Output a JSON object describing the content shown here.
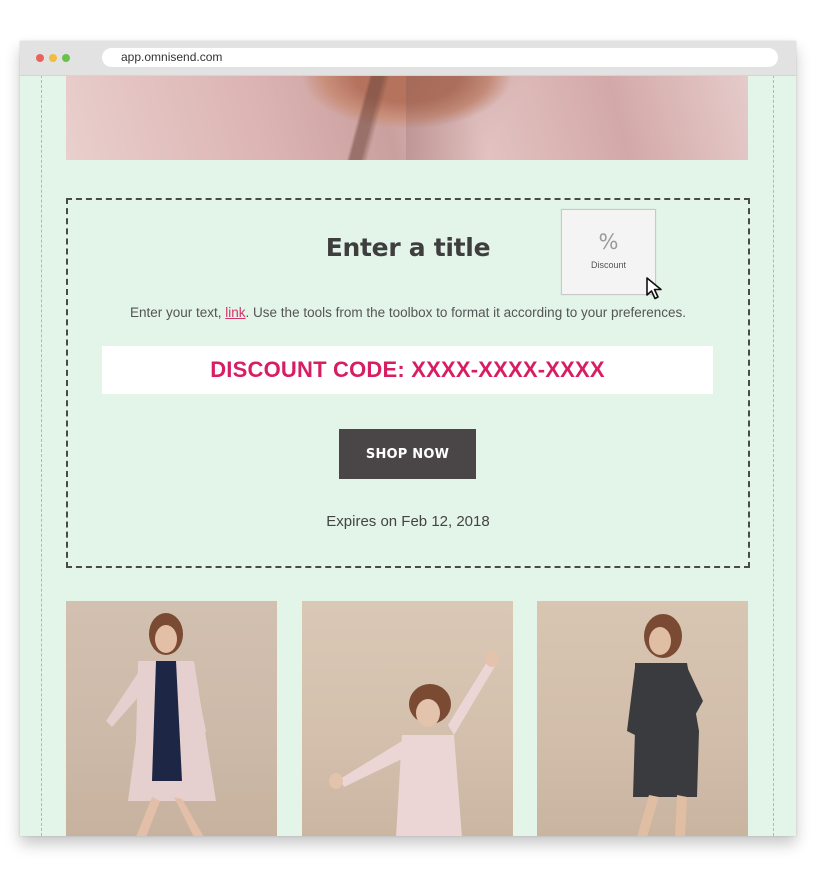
{
  "browser": {
    "url": "app.omnisend.com"
  },
  "block": {
    "title": "Enter a title",
    "text_before_link": "Enter your text, ",
    "link_text": "link",
    "text_after_link": ". Use the tools from the toolbox to format it according to your preferences.",
    "discount_code": "DISCOUNT CODE: XXXX-XXXX-XXXX",
    "button_label": "SHOP NOW",
    "expires": "Expires on Feb 12, 2018"
  },
  "discount_tile": {
    "symbol": "%",
    "label": "Discount"
  },
  "colors": {
    "canvas_background": "#e3f4e8",
    "discount_code_text": "#d81e63",
    "button_background": "#4a4546"
  }
}
